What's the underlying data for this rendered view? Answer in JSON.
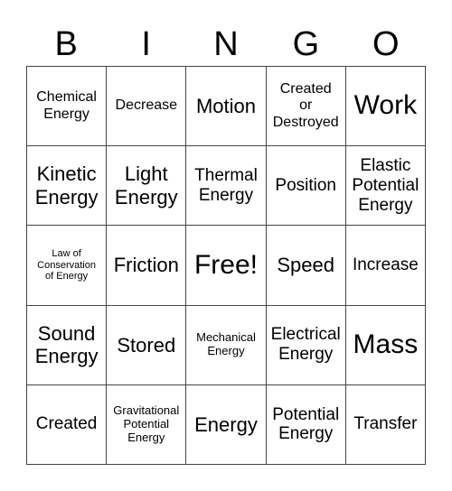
{
  "header": {
    "letters": [
      "B",
      "I",
      "N",
      "G",
      "O"
    ]
  },
  "board": {
    "rows": [
      [
        "Chemical\nEnergy",
        "Decrease",
        "Motion",
        "Created\nor\nDestroyed",
        "Work"
      ],
      [
        "Kinetic\nEnergy",
        "Light\nEnergy",
        "Thermal\nEnergy",
        "Position",
        "Elastic\nPotential\nEnergy"
      ],
      [
        "Law of\nConservation\nof Energy",
        "Friction",
        "Free!",
        "Speed",
        "Increase"
      ],
      [
        "Sound\nEnergy",
        "Stored",
        "Mechanical\nEnergy",
        "Electrical\nEnergy",
        "Mass"
      ],
      [
        "Created",
        "Gravitational\nPotential\nEnergy",
        "Energy",
        "Potential\nEnergy",
        "Transfer"
      ]
    ]
  }
}
